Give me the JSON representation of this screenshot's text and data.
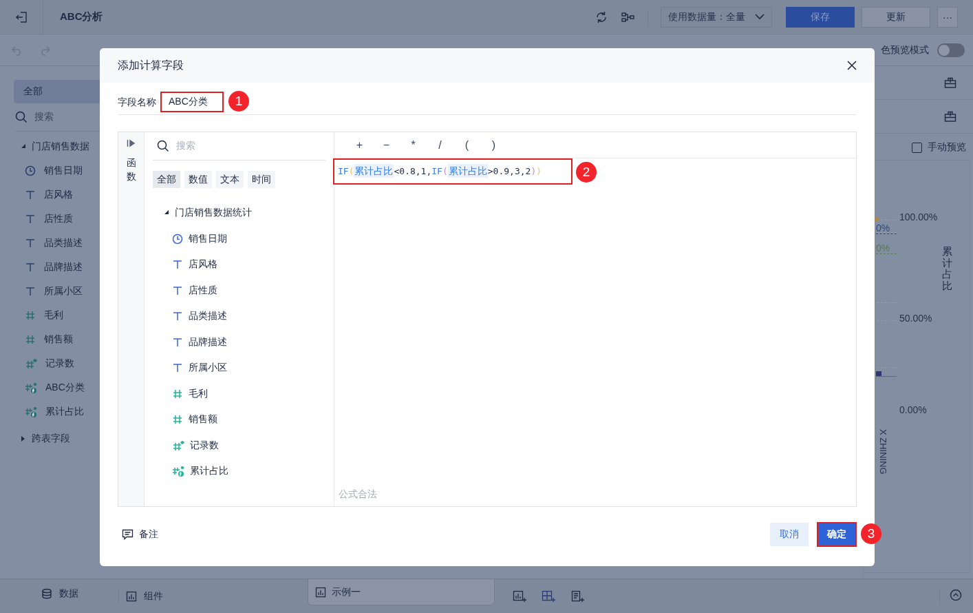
{
  "topbar": {
    "title": "ABC分析",
    "data_scope": "使用数据量：全量",
    "buttons": [
      {
        "label": "保存",
        "kind": "primary"
      },
      {
        "label": "更新",
        "kind": "default"
      },
      {
        "label": "···",
        "kind": "more"
      }
    ]
  },
  "toolbar": {
    "preview_mode_label": "色预览模式",
    "preview_mode_on": false
  },
  "sidebar": {
    "tab": "全部",
    "search_placeholder": "搜索",
    "tree": [
      {
        "label": "门店销售数据",
        "expanded": true,
        "children": [
          {
            "label": "销售日期",
            "kind": "date"
          },
          {
            "label": "店风格",
            "kind": "text"
          },
          {
            "label": "店性质",
            "kind": "text"
          },
          {
            "label": "品类描述",
            "kind": "text"
          },
          {
            "label": "品牌描述",
            "kind": "text"
          },
          {
            "label": "所属小区",
            "kind": "text"
          },
          {
            "label": "毛利",
            "kind": "number"
          },
          {
            "label": "销售额",
            "kind": "number"
          },
          {
            "label": "记录数",
            "kind": "count"
          },
          {
            "label": "ABC分类",
            "kind": "formula"
          },
          {
            "label": "累计占比",
            "kind": "formula"
          }
        ]
      },
      {
        "label": "跨表字段",
        "expanded": false
      }
    ]
  },
  "right_panel": {
    "manual_preview_label": "手动预览",
    "manual_preview_checked": false,
    "axis_labels": [
      "100.00%",
      "50.00%",
      "0.00%"
    ],
    "axis_title": "累计占比",
    "category_label": "X ZHINING",
    "line_labels": [
      {
        "text": "0%",
        "color": "#2e4a7a"
      },
      {
        "text": "0%",
        "color": "#5a7a4e"
      }
    ]
  },
  "bottom_bar": {
    "tabs": [
      {
        "label": "数据",
        "kind": "data"
      },
      {
        "label": "组件",
        "kind": "component"
      }
    ],
    "sheet_tabs": [
      {
        "label": "示例一",
        "selected": true
      }
    ]
  },
  "dialog": {
    "title": "添加计算字段",
    "name_label": "字段名称",
    "name_value": "ABC分类",
    "function_tab": "函数",
    "search_placeholder": "搜索",
    "filter_tabs": [
      {
        "label": "全部",
        "selected": true
      },
      {
        "label": "数值",
        "selected": false
      },
      {
        "label": "文本",
        "selected": false
      },
      {
        "label": "时间",
        "selected": false
      }
    ],
    "tree": {
      "label": "门店销售数据统计",
      "expanded": true,
      "children": [
        {
          "label": "销售日期",
          "kind": "date"
        },
        {
          "label": "店风格",
          "kind": "text"
        },
        {
          "label": "店性质",
          "kind": "text"
        },
        {
          "label": "品类描述",
          "kind": "text"
        },
        {
          "label": "品牌描述",
          "kind": "text"
        },
        {
          "label": "所属小区",
          "kind": "text"
        },
        {
          "label": "毛利",
          "kind": "number"
        },
        {
          "label": "销售额",
          "kind": "number"
        },
        {
          "label": "记录数",
          "kind": "count"
        },
        {
          "label": "累计占比",
          "kind": "formula"
        }
      ]
    },
    "operators": [
      "+",
      "−",
      "*",
      "/",
      "(",
      ")"
    ],
    "formula": [
      {
        "text": "IF",
        "kind": "function"
      },
      {
        "text": "(",
        "kind": "paren",
        "color": "#e8c56a"
      },
      {
        "text": "累计占比",
        "kind": "field"
      },
      {
        "text": "<0.8,1,",
        "kind": "plain"
      },
      {
        "text": "IF",
        "kind": "function"
      },
      {
        "text": "(",
        "kind": "paren",
        "color": "#c58be0"
      },
      {
        "text": "累计占比",
        "kind": "field"
      },
      {
        "text": ">0.9,3,2",
        "kind": "plain"
      },
      {
        "text": ")",
        "kind": "paren",
        "color": "#c58be0"
      },
      {
        "text": ")",
        "kind": "paren",
        "color": "#e8c56a"
      }
    ],
    "status": "公式合法",
    "note_label": "备注",
    "buttons": [
      {
        "label": "取消",
        "kind": "secondary"
      },
      {
        "label": "确定",
        "kind": "primary"
      }
    ],
    "callouts": [
      "1",
      "2",
      "3"
    ]
  }
}
